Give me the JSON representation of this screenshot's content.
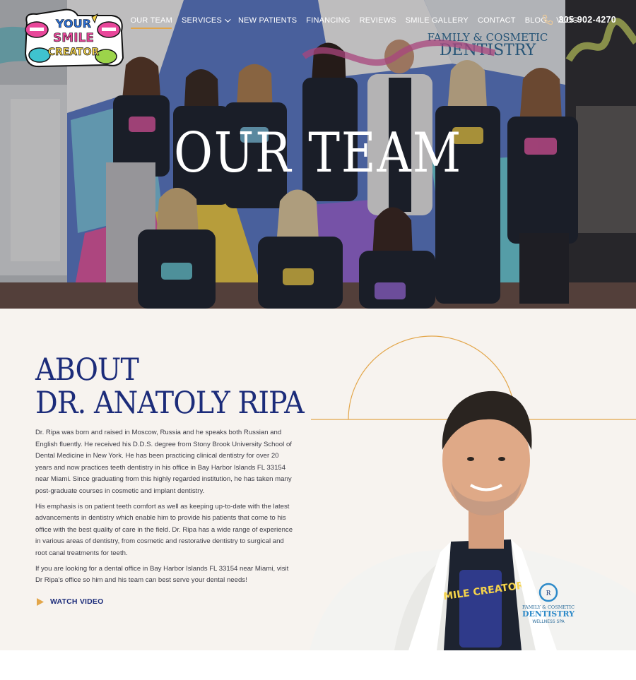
{
  "header": {
    "logo_lines": [
      "YOUR",
      "SMILE",
      "CREATOR"
    ],
    "nav": [
      {
        "label": "OUR TEAM",
        "active": true
      },
      {
        "label": "SERVICES",
        "dropdown": true
      },
      {
        "label": "NEW PATIENTS"
      },
      {
        "label": "FINANCING"
      },
      {
        "label": "REVIEWS"
      },
      {
        "label": "SMILE GALLERY"
      },
      {
        "label": "CONTACT"
      },
      {
        "label": "BLOG"
      },
      {
        "label": "VLOG"
      }
    ],
    "phone": "305-902-4270"
  },
  "hero": {
    "title": "OUR TEAM",
    "backdrop_text": "FAMILY & COSMETIC DENTISTRY"
  },
  "about": {
    "heading_line1": "ABOUT",
    "heading_line2": "DR. ANATOLY RIPA",
    "paragraphs": [
      "Dr. Ripa was born and raised in Moscow, Russia and he speaks both Russian and English fluently. He received his D.D.S. degree from Stony Brook University School of Dental Medicine in New York. He has been practicing clinical dentistry for over 20 years and now practices teeth dentistry in his office in Bay Harbor Islands FL 33154 near Miami. Since graduating from this highly regarded institution, he has taken many post-graduate courses in cosmetic and implant dentistry.",
      "His emphasis is on patient teeth comfort as well as keeping up-to-date with the latest advancements in dentistry which enable him to provide his patients that come to his office with the best quality of care in the field. Dr. Ripa has a wide range of experience in various areas of dentistry, from cosmetic and restorative dentistry to surgical and root canal treatments for teeth.",
      "If you are looking for a dental office in Bay Harbor Islands FL 33154 near Miami, visit Dr Ripa's office so him and his team can best serve your dental needs!"
    ],
    "watch_video": "WATCH VIDEO",
    "coat_logo_lines": [
      "FAMILY & COSMETIC",
      "DENTISTRY",
      "WELLNESS SPA"
    ],
    "shirt_text": "SMILE CREATOR"
  },
  "colors": {
    "accent": "#e3a64a",
    "navy": "#1c2c7a",
    "cream": "#f7f3ef"
  }
}
